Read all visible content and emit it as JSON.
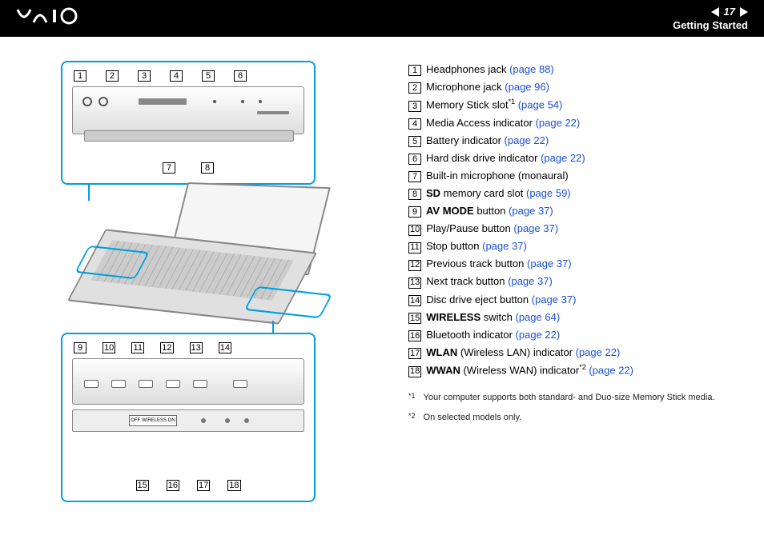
{
  "header": {
    "logo": "VAIO",
    "page_number": "17",
    "section": "Getting Started"
  },
  "diagram_top_callouts_upper": [
    "1",
    "2",
    "3",
    "4",
    "5",
    "6"
  ],
  "diagram_top_callouts_lower": [
    "7",
    "8"
  ],
  "diagram_bot_callouts_upper": [
    "9",
    "10",
    "11",
    "12",
    "13",
    "14"
  ],
  "diagram_bot_callouts_lower": [
    "15",
    "16",
    "17",
    "18"
  ],
  "legend": [
    {
      "num": "1",
      "text": "Headphones jack ",
      "link": "(page 88)"
    },
    {
      "num": "2",
      "text": "Microphone jack ",
      "link": "(page 96)"
    },
    {
      "num": "3",
      "pre": "Memory Stick slot",
      "sup": "*1",
      "sp": " ",
      "link": "(page 54)"
    },
    {
      "num": "4",
      "text": "Media Access indicator ",
      "link": "(page 22)"
    },
    {
      "num": "5",
      "text": "Battery indicator ",
      "link": "(page 22)"
    },
    {
      "num": "6",
      "text": "Hard disk drive indicator ",
      "link": "(page 22)"
    },
    {
      "num": "7",
      "text": "Built-in microphone (monaural)"
    },
    {
      "num": "8",
      "bold": "SD",
      "text": " memory card slot ",
      "link": "(page 59)"
    },
    {
      "num": "9",
      "bold": "AV MODE",
      "text": " button ",
      "link": "(page 37)"
    },
    {
      "num": "10",
      "text": "Play/Pause button ",
      "link": "(page 37)"
    },
    {
      "num": "11",
      "text": "Stop button ",
      "link": "(page 37)"
    },
    {
      "num": "12",
      "text": "Previous track button ",
      "link": "(page 37)"
    },
    {
      "num": "13",
      "text": "Next track button ",
      "link": "(page 37)"
    },
    {
      "num": "14",
      "text": "Disc drive eject button ",
      "link": "(page 37)"
    },
    {
      "num": "15",
      "bold": "WIRELESS",
      "text": " switch ",
      "link": "(page 64)"
    },
    {
      "num": "16",
      "text": "Bluetooth indicator ",
      "link": "(page 22)"
    },
    {
      "num": "17",
      "bold": "WLAN",
      "text": " (Wireless LAN) indicator ",
      "link": "(page 22)"
    },
    {
      "num": "18",
      "bold": "WWAN",
      "text": " (Wireless WAN) indicator",
      "sup": "*2",
      "sp": " ",
      "link": "(page 22)"
    }
  ],
  "footnotes": [
    {
      "mark": "*1",
      "text": "Your computer supports both standard- and Duo-size Memory Stick media."
    },
    {
      "mark": "*2",
      "text": "On selected models only."
    }
  ],
  "switch_label": "OFF WIRELESS ON"
}
